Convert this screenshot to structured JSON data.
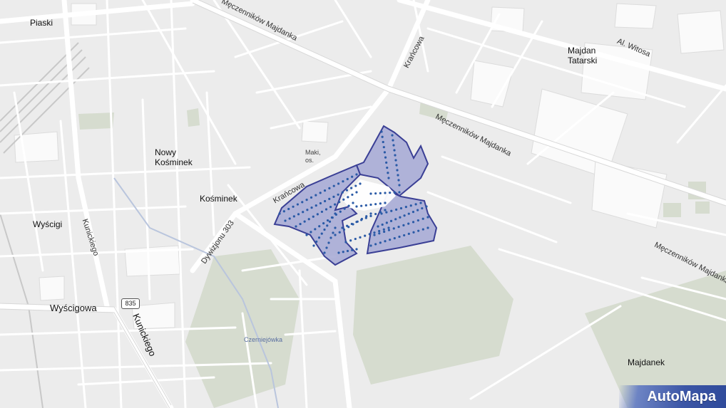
{
  "places": {
    "piaski": "Piaski",
    "nowy_kosminek": [
      "Nowy",
      "Kośminek"
    ],
    "kosminek": "Kośminek",
    "wyscigi": "Wyścigi",
    "majdan_tatarski": [
      "Majdan",
      "Tatarski"
    ],
    "majdanek": "Majdanek",
    "maki": [
      "Maki,",
      "os."
    ],
    "czerniejowka": "Czerniejówka"
  },
  "streets": {
    "meczennikow_top": "Męczenników Majdanka",
    "meczennikow_mid": "Męczenników Majdanka",
    "meczennikow_right": "Męczenników Majdanka",
    "krancowa_top": "Krańcowa",
    "krancowa_mid": "Krańcowa",
    "witosa": "Al. Witosa",
    "dywizjonu": "Dywizjonu 303",
    "kunickiego_left": "Kunickiego",
    "kunickiego_bottom": "Kunickiego",
    "wyscigowa": "Wyścigowa"
  },
  "road_badge": "835",
  "logo": "AutoMapa",
  "colors": {
    "background": "#ececec",
    "road": "#ffffff",
    "green": "#d3dccd",
    "highlight_fill": "#a9acd6",
    "highlight_stroke": "#3a3f95",
    "dots": "#2a5aa6"
  }
}
